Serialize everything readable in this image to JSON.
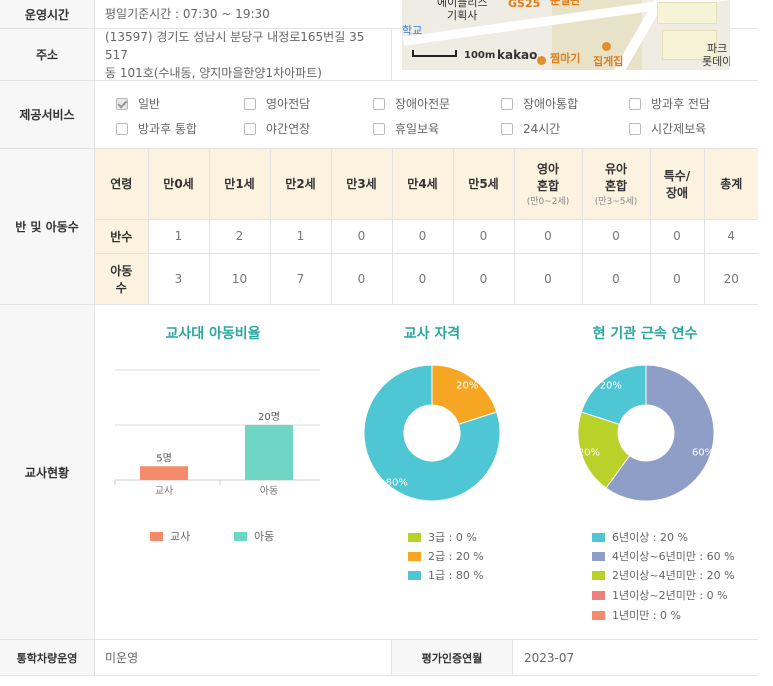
{
  "hours": {
    "label": "운영시간",
    "value": "평일기준시간 : 07:30 ~ 19:30"
  },
  "address": {
    "label": "주소",
    "line1": "(13597) 경기도 성남시 분당구 내정로165번길 35 517",
    "line2": "동 101호(수내동, 양지마을한양1차아파트)"
  },
  "map": {
    "labels": [
      "에이블리스",
      "기획사",
      "GS25",
      "문일관",
      "학교",
      "100m",
      "kakao",
      "찜마기",
      "집게집",
      "파크",
      "롯데아"
    ]
  },
  "services": {
    "label": "제공서비스",
    "items": [
      {
        "label": "일반",
        "checked": true
      },
      {
        "label": "영아전담",
        "checked": false
      },
      {
        "label": "장애아전문",
        "checked": false
      },
      {
        "label": "장애아통합",
        "checked": false
      },
      {
        "label": "방과후 전담",
        "checked": false
      },
      {
        "label": "방과후 통합",
        "checked": false
      },
      {
        "label": "야간연장",
        "checked": false
      },
      {
        "label": "휴일보육",
        "checked": false
      },
      {
        "label": "24시간",
        "checked": false
      },
      {
        "label": "시간제보육",
        "checked": false
      }
    ]
  },
  "classes": {
    "label": "반 및 아동수",
    "headers": [
      "연령",
      "만0세",
      "만1세",
      "만2세",
      "만3세",
      "만4세",
      "만5세",
      "영아|혼합|(만0~2세)",
      "유아|혼합|(만3~5세)",
      "특수/|장애",
      "총계"
    ],
    "rows": [
      {
        "label": "반수",
        "values": [
          "1",
          "2",
          "1",
          "0",
          "0",
          "0",
          "0",
          "0",
          "0",
          "4"
        ]
      },
      {
        "label": "아동|수",
        "values": [
          "3",
          "10",
          "7",
          "0",
          "0",
          "0",
          "0",
          "0",
          "0",
          "20"
        ]
      }
    ]
  },
  "teachers": {
    "label": "교사현황"
  },
  "transport": {
    "label": "통학차량운영",
    "value": "미운영",
    "cert_label": "평가인증연월",
    "cert_value": "2023-07"
  },
  "colors": {
    "teacher": "#f58b6b",
    "child": "#6fd6c6",
    "grade1": "#4ec6d3",
    "grade2": "#f6a623",
    "grade3": "#b9d22a",
    "y6": "#4ec6d3",
    "y46": "#8f9ec7",
    "y24": "#b9d22a",
    "y12": "#f07f7f",
    "y1": "#f58b6b"
  },
  "chart_data": [
    {
      "type": "bar",
      "title": "교사대 아동비율",
      "categories": [
        "교사",
        "아동"
      ],
      "values": [
        5,
        20
      ],
      "data_labels": [
        "5명",
        "20명"
      ],
      "legend": [
        "교사",
        "아동"
      ]
    },
    {
      "type": "pie",
      "title": "교사 자격",
      "series": [
        {
          "name": "3급 : 0 %",
          "value": 0
        },
        {
          "name": "2급 : 20 %",
          "value": 20
        },
        {
          "name": "1급 : 80 %",
          "value": 80
        }
      ]
    },
    {
      "type": "pie",
      "title": "현 기관 근속 연수",
      "series": [
        {
          "name": "6년이상 : 20 %",
          "value": 20
        },
        {
          "name": "4년이상~6년미만 : 60 %",
          "value": 60
        },
        {
          "name": "2년이상~4년미만 : 20 %",
          "value": 20
        },
        {
          "name": "1년이상~2년미만 : 0 %",
          "value": 0
        },
        {
          "name": "1년미만 : 0 %",
          "value": 0
        }
      ]
    }
  ]
}
